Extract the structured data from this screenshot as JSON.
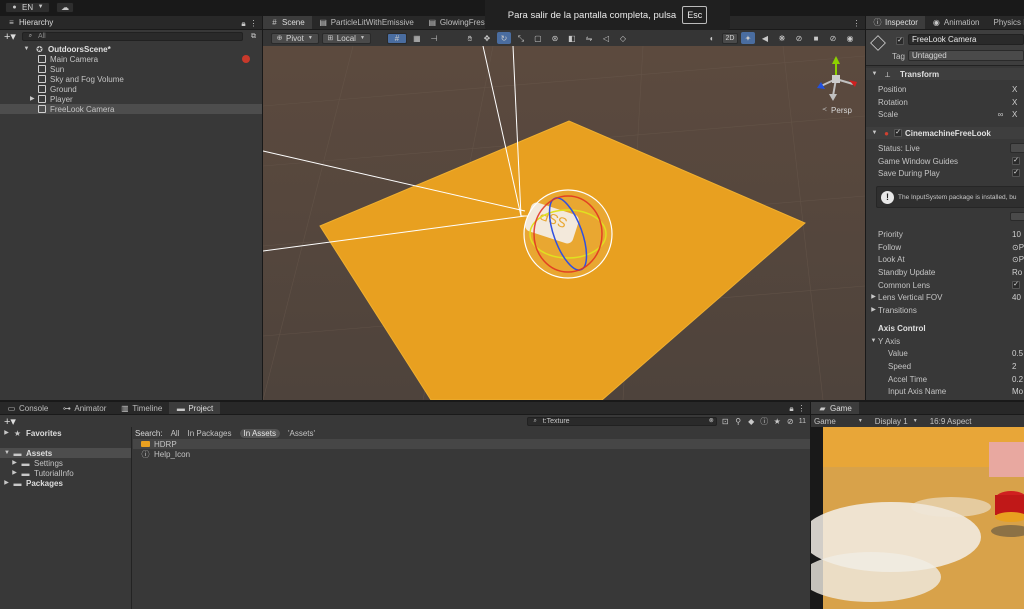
{
  "topbar": {
    "language": "EN",
    "fullscreen_message": "Para salir de la pantalla completa, pulsa",
    "fullscreen_key": "Esc"
  },
  "hierarchy": {
    "tab_label": "Hierarchy",
    "search_placeholder": "All",
    "scene_name": "OutdoorsScene*",
    "items": [
      {
        "label": "Main Camera"
      },
      {
        "label": "Sun"
      },
      {
        "label": "Sky and Fog Volume"
      },
      {
        "label": "Ground"
      },
      {
        "label": "Player"
      },
      {
        "label": "FreeLook Camera"
      }
    ]
  },
  "scene_tabs": [
    "Scene",
    "ParticleLitWithEmissive",
    "GlowingFresnel"
  ],
  "scene_toolbar": {
    "pivot": "Pivot",
    "local": "Local",
    "mode_2d": "2D",
    "persp_label": "Persp"
  },
  "colors": {
    "accent": "#4a7fd6",
    "ground": "#e8a020",
    "panel": "#383838",
    "viewport_bg": "#5a4a40"
  },
  "inspector": {
    "tabs": [
      "Inspector",
      "Animation",
      "Physics D"
    ],
    "object_name": "FreeLook Camera",
    "tag_label": "Tag",
    "tag_value": "Untagged",
    "transform": {
      "title": "Transform",
      "rows": [
        {
          "label": "Position",
          "axis": "X"
        },
        {
          "label": "Rotation",
          "axis": "X"
        },
        {
          "label": "Scale",
          "axis": "X"
        }
      ]
    },
    "cinemachine": {
      "title": "CinemachineFreeLook",
      "status": "Status: Live",
      "rows_top": [
        {
          "label": "Game Window Guides",
          "value": "✓"
        },
        {
          "label": "Save During Play",
          "value": "✓"
        }
      ],
      "warning": "The InputSystem package is installed, bu",
      "rows": [
        {
          "label": "Priority",
          "value": "10"
        },
        {
          "label": "Follow",
          "value": "⊙P"
        },
        {
          "label": "Look At",
          "value": "⊙P"
        },
        {
          "label": "Standby Update",
          "value": "Ro"
        },
        {
          "label": "Common Lens",
          "value": "✓"
        },
        {
          "label": "Lens Vertical FOV",
          "value": "40"
        },
        {
          "label": "Transitions",
          "value": ""
        }
      ],
      "axis_control": "Axis Control",
      "y_axis": "Y Axis",
      "axis_rows": [
        {
          "label": "Value",
          "value": "0.5"
        },
        {
          "label": "Speed",
          "value": "2"
        },
        {
          "label": "Accel Time",
          "value": "0.2"
        },
        {
          "label": "Input Axis Name",
          "value": "Mo"
        }
      ]
    }
  },
  "bottom_tabs": [
    "Console",
    "Animator",
    "Timeline",
    "Project"
  ],
  "project": {
    "search_value": "t:Texture",
    "count": "11",
    "favorites": "Favorites",
    "tree": [
      {
        "label": "Assets",
        "level": 0
      },
      {
        "label": "Settings",
        "level": 1
      },
      {
        "label": "TutorialInfo",
        "level": 1
      },
      {
        "label": "Packages",
        "level": 0
      }
    ],
    "search_label": "Search:",
    "search_scopes": [
      "All",
      "In Packages",
      "In Assets",
      "'Assets'"
    ],
    "results": [
      {
        "label": "HDRP",
        "icon": "folder-icon"
      },
      {
        "label": "Help_Icon",
        "icon": "info-icon"
      }
    ]
  },
  "game": {
    "tab_label": "Game",
    "mode": "Game",
    "display": "Display 1",
    "aspect": "16:9 Aspect"
  }
}
